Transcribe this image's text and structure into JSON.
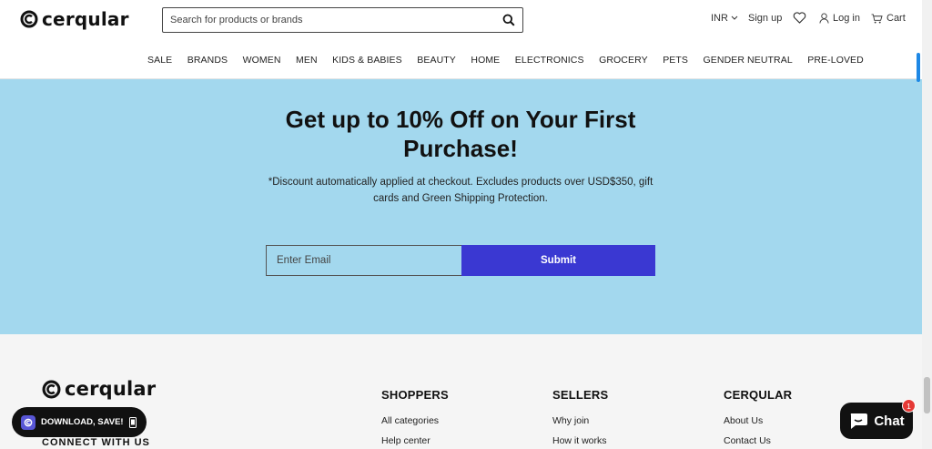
{
  "header": {
    "brand": "cerqular",
    "search_placeholder": "Search for products or brands",
    "currency": "INR",
    "signup": "Sign up",
    "login": "Log in",
    "cart": "Cart"
  },
  "nav": {
    "items": [
      "SALE",
      "BRANDS",
      "WOMEN",
      "MEN",
      "KIDS & BABIES",
      "BEAUTY",
      "HOME",
      "ELECTRONICS",
      "GROCERY",
      "PETS",
      "GENDER NEUTRAL",
      "PRE-LOVED"
    ]
  },
  "hero": {
    "title": "Get up to 10% Off on Your First Purchase!",
    "subtitle": "*Discount automatically applied at checkout. Excludes products over USD$350, gift cards and Green Shipping Protection.",
    "email_placeholder": "Enter Email",
    "submit": "Submit",
    "background": "#a3d8ee",
    "button_color": "#3a38d2"
  },
  "footer": {
    "brand": "cerqular",
    "connect": "CONNECT WITH US",
    "columns": [
      {
        "heading": "SHOPPERS",
        "links": [
          "All categories",
          "Help center"
        ]
      },
      {
        "heading": "SELLERS",
        "links": [
          "Why join",
          "How it works"
        ]
      },
      {
        "heading": "CERQULAR",
        "links": [
          "About Us",
          "Contact Us"
        ]
      }
    ]
  },
  "download": {
    "label": "DOWNLOAD, SAVE!"
  },
  "chat": {
    "label": "Chat",
    "count": "1"
  }
}
